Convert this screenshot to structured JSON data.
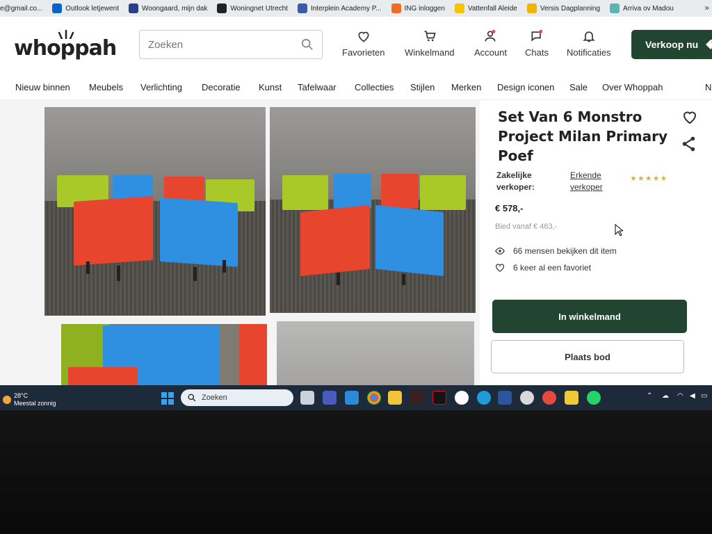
{
  "bookmarks": [
    {
      "label": "e@gmail.co...",
      "color": "#ffffff"
    },
    {
      "label": "Outlook letjewent",
      "color": "#0a64c8"
    },
    {
      "label": "Woongaard, mijn dak",
      "color": "#2a3f8a"
    },
    {
      "label": "Woningnet Utrecht",
      "color": "#222222"
    },
    {
      "label": "Interplein Academy P...",
      "color": "#3d5aa8"
    },
    {
      "label": "ING inloggen",
      "color": "#f26b21"
    },
    {
      "label": "Vattenfall Aleide",
      "color": "#f5c400"
    },
    {
      "label": "Versis Dagplanning",
      "color": "#f0b400"
    },
    {
      "label": "Arriva ov Madou",
      "color": "#5ab4b4"
    }
  ],
  "header": {
    "logo": "whoppah",
    "search_placeholder": "Zoeken",
    "nav": {
      "favorites": "Favorieten",
      "cart": "Winkelmand",
      "account": "Account",
      "chats": "Chats",
      "notifications": "Notificaties"
    },
    "sell_button": "Verkoop nu"
  },
  "categories": [
    "Nieuw binnen",
    "Meubels",
    "Verlichting",
    "Decoratie",
    "Kunst",
    "Tafelwaar",
    "Collecties",
    "Stijlen",
    "Merken",
    "Design iconen",
    "Sale",
    "Over Whoppah",
    "N"
  ],
  "product": {
    "title": "Set Van 6 Monstro Project Milan Primary Poef",
    "seller_label": "Zakelijke verkoper:",
    "seller_value": "Erkende verkoper",
    "rating_stars": "★★★★★",
    "price": "€ 578,-",
    "bid_from": "Bied vanaf € 463,-",
    "viewers": "66 mensen bekijken dit item",
    "favorites": "6 keer al een favoriet",
    "add_to_cart": "In winkelmand",
    "place_bid": "Plaats bod"
  },
  "taskbar": {
    "temp": "28°C",
    "weather": "Meestal zonnig",
    "search": "Zoeken"
  },
  "colors": {
    "brand_dark_green": "#214530",
    "cube_green": "#a9c928",
    "cube_blue": "#2f8fe0",
    "cube_red": "#e8452e"
  }
}
